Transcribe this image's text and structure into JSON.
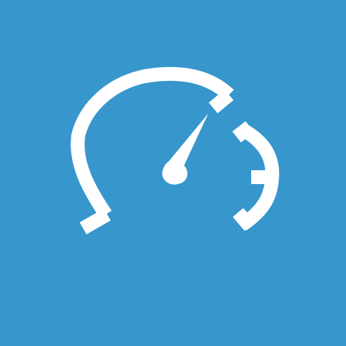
{
  "app_tile": {
    "background_color": "#3796cc",
    "foreground_color": "#ffffff",
    "icon": "speedometer-icon"
  }
}
